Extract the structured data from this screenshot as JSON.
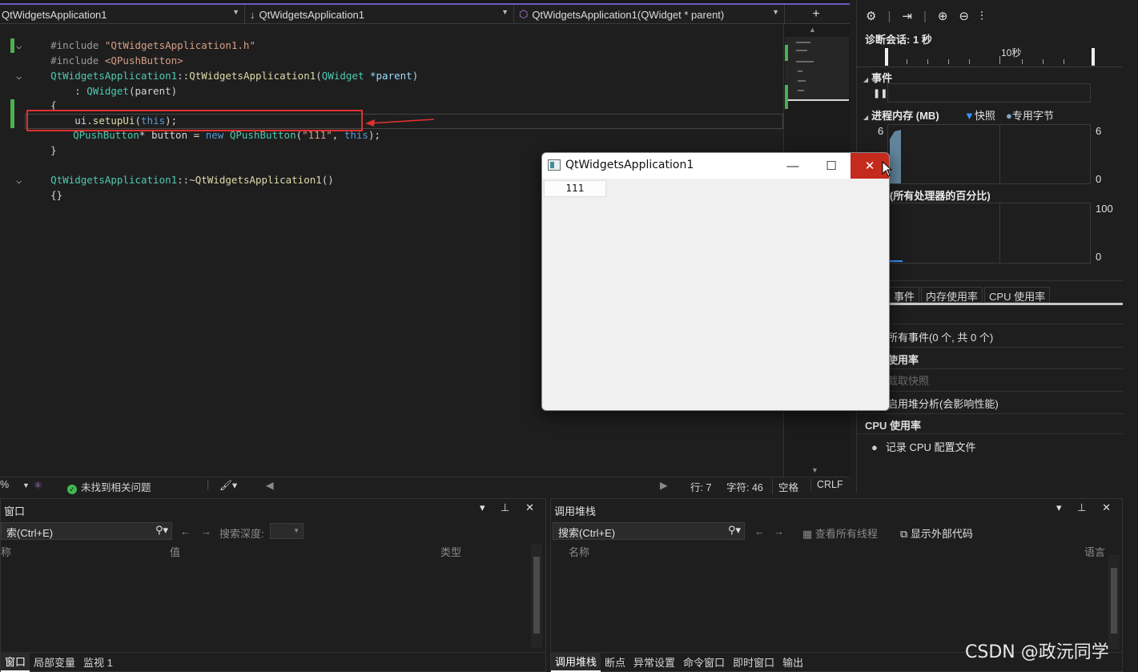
{
  "editor": {
    "nav": {
      "project": "QtWidgetsApplication1",
      "scope": "QtWidgetsApplication1",
      "member": "QtWidgetsApplication1(QWidget * parent)"
    },
    "code": {
      "l1_pp": "#include ",
      "l1_str": "\"QtWidgetsApplication1.h\"",
      "l2_pp": "#include ",
      "l2_str": "<QPushButton>",
      "l3_cls": "QtWidgetsApplication1",
      "l3_sep": "::",
      "l3_fn": "QtWidgetsApplication1",
      "l3_open": "(",
      "l3_ty": "QWidget",
      "l3_rest": " *parent)",
      "l4_pre": "    : ",
      "l4_ty": "QWidget",
      "l4_rest": "(parent)",
      "l5": "{",
      "l7_a": "    ui.",
      "l7_fn": "setupUi",
      "l7_b": "(",
      "l7_kw": "this",
      "l7_c": ");",
      "l8_ty": "QPushButton",
      "l8_a": "* button = ",
      "l8_kw": "new",
      "l8_sp": " ",
      "l8_ty2": "QPushButton",
      "l8_b": "(",
      "l8_str": "\"111\"",
      "l8_c": ", ",
      "l8_kw2": "this",
      "l8_d": ");",
      "l9": "}",
      "l11_cls": "QtWidgetsApplication1",
      "l11_sep": "::~",
      "l11_fn": "QtWidgetsApplication1",
      "l11_rest": "()",
      "l12": "{}"
    },
    "status": {
      "zoom": "%",
      "issues": "未找到相关问题",
      "line": "行: 7",
      "char": "字符: 46",
      "spaces": "空格",
      "eol": "CRLF"
    }
  },
  "diagnostics": {
    "session": "诊断会话: 1 秒",
    "ruler_label": "10秒",
    "events_header": "事件",
    "memory_header": "进程内存 (MB)",
    "legend_snapshot": "快照",
    "legend_private": "专用字节",
    "mem_ymax": "6",
    "mem_ymin": "0",
    "mem_ymax_left": "6",
    "cpu_header": "U (所有处理器的百分比)",
    "cpu_ymax": "100",
    "cpu_ymin": "0",
    "tabs": [
      "事件",
      "内存使用率",
      "CPU 使用率"
    ],
    "all_events": "所有事件(0 个, 共 0 个)",
    "mem_usage": "使用率",
    "take_snapshot": "截取快照",
    "heap_profile": "启用堆分析(会影响性能)",
    "cpu_usage": "CPU 使用率",
    "record_cpu": "记录 CPU 配置文件",
    "colors": {
      "snapshot": "#3794ff",
      "private": "#7aa8c8"
    }
  },
  "qtwindow": {
    "title": "QtWidgetsApplication1",
    "button": "111",
    "minimize": "—",
    "maximize": "☐",
    "close": "✕",
    "colors": {
      "close_bg": "#c42b1c"
    }
  },
  "watch": {
    "title": "窗口",
    "search": "索(Ctrl+E)",
    "search_depth": "搜索深度:",
    "col_name": "称",
    "col_value": "值",
    "col_type": "类型",
    "tabs": [
      "窗口",
      "局部变量",
      "监视 1"
    ]
  },
  "callstack": {
    "title": "调用堆栈",
    "search": "搜索(Ctrl+E)",
    "all_threads": "查看所有线程",
    "external_code": "显示外部代码",
    "col_name": "名称",
    "col_lang": "语言",
    "tabs": [
      "调用堆栈",
      "断点",
      "异常设置",
      "命令窗口",
      "即时窗口",
      "输出"
    ]
  },
  "watermark": "CSDN @政沅同学"
}
